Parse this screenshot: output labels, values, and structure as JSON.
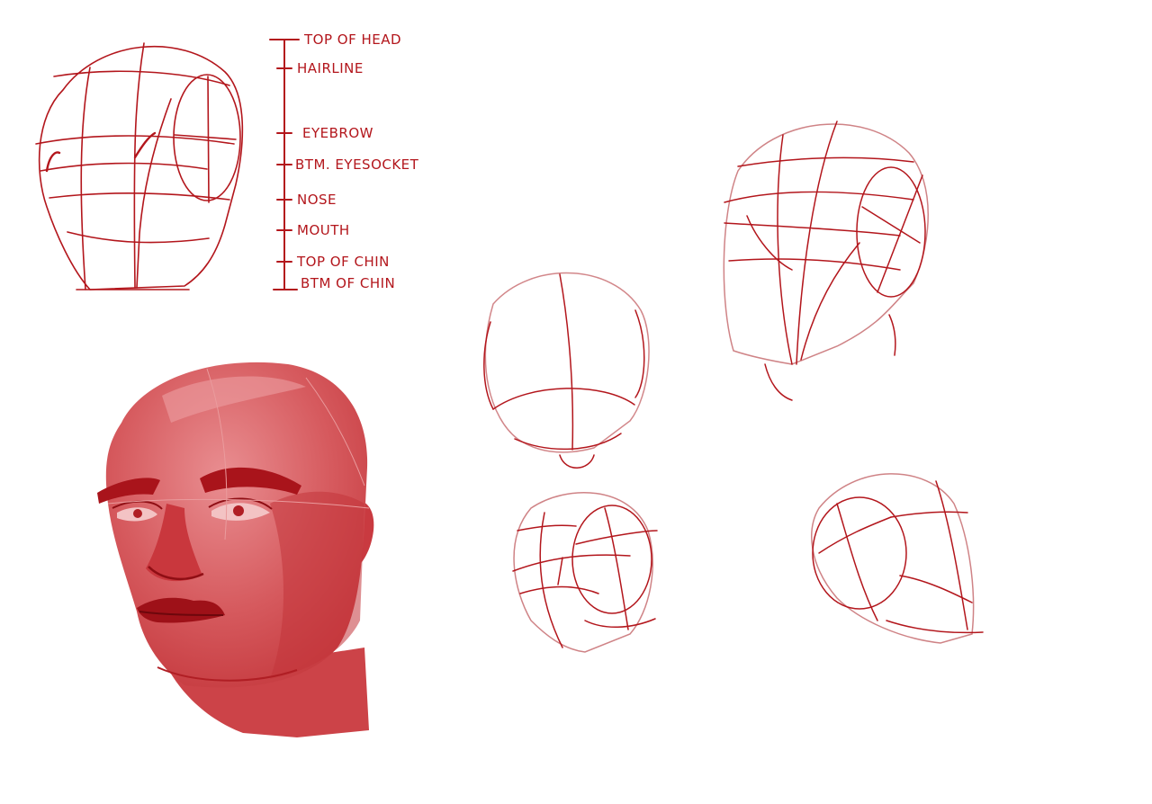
{
  "colors": {
    "ink": "#b3161c",
    "ink_light": "#c74a4f",
    "skin": "#d6575b",
    "skin_light": "#ea9b9d",
    "skin_dark": "#b01e24",
    "background": "#ffffff"
  },
  "proportion_labels": {
    "top_of_head": "TOP OF HEAD",
    "hairline": "HAIRLINE",
    "eyebrow": "EYEBROW",
    "bottom_eyesocket": "BTM. EYESOCKET",
    "nose": "NOSE",
    "mouth": "MOUTH",
    "top_of_chin": "TOP OF CHIN",
    "bottom_of_chin": "BTM OF CHIN"
  }
}
